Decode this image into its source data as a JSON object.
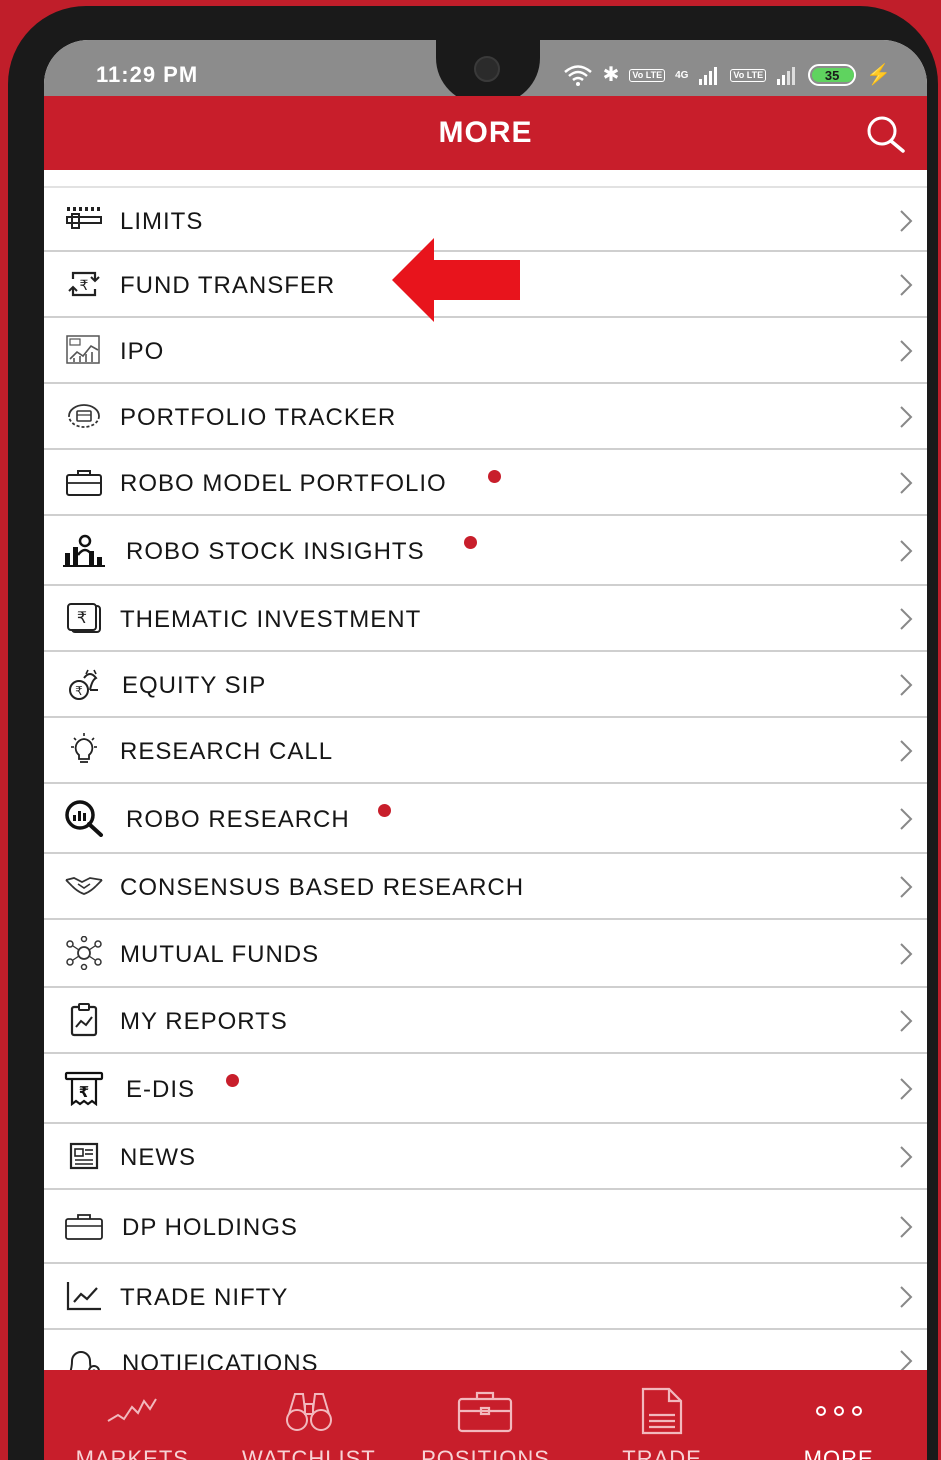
{
  "status_bar": {
    "time": "11:29 PM",
    "network": "4G",
    "lte_badge": "Vo LTE",
    "battery": "35"
  },
  "header": {
    "title": "MORE",
    "search_icon": "search-icon"
  },
  "menu_items": [
    {
      "label": "LIMITS",
      "icon": "limits-icon",
      "dot": false
    },
    {
      "label": "FUND TRANSFER",
      "icon": "fund-transfer-icon",
      "dot": false
    },
    {
      "label": "IPO",
      "icon": "ipo-icon",
      "dot": false
    },
    {
      "label": "PORTFOLIO TRACKER",
      "icon": "portfolio-tracker-icon",
      "dot": false
    },
    {
      "label": "ROBO MODEL PORTFOLIO",
      "icon": "briefcase-icon",
      "dot": true
    },
    {
      "label": "ROBO STOCK INSIGHTS",
      "icon": "stock-insights-icon",
      "dot": true
    },
    {
      "label": "THEMATIC INVESTMENT",
      "icon": "rupee-note-icon",
      "dot": false
    },
    {
      "label": "EQUITY SIP",
      "icon": "sip-icon",
      "dot": false
    },
    {
      "label": "RESEARCH CALL",
      "icon": "lightbulb-icon",
      "dot": false
    },
    {
      "label": "ROBO RESEARCH",
      "icon": "magnifier-chart-icon",
      "dot": true
    },
    {
      "label": "CONSENSUS BASED RESEARCH",
      "icon": "handshake-icon",
      "dot": false
    },
    {
      "label": "MUTUAL FUNDS",
      "icon": "mutual-funds-icon",
      "dot": false
    },
    {
      "label": "MY REPORTS",
      "icon": "clipboard-chart-icon",
      "dot": false
    },
    {
      "label": "E-DIS",
      "icon": "receipt-rupee-icon",
      "dot": true
    },
    {
      "label": "NEWS",
      "icon": "newspaper-icon",
      "dot": false
    },
    {
      "label": "DP HOLDINGS",
      "icon": "briefcase-icon",
      "dot": false
    },
    {
      "label": "TRADE NIFTY",
      "icon": "line-chart-icon",
      "dot": false
    },
    {
      "label": "NOTIFICATIONS",
      "icon": "bell-gear-icon",
      "dot": false
    }
  ],
  "bottom_nav": [
    {
      "label": "MARKETS",
      "icon": "markets-icon",
      "active": false
    },
    {
      "label": "WATCHLIST",
      "icon": "binoculars-icon",
      "active": false
    },
    {
      "label": "POSITIONS",
      "icon": "briefcase-icon",
      "active": false
    },
    {
      "label": "TRADE",
      "icon": "document-icon",
      "active": false
    },
    {
      "label": "MORE",
      "icon": "more-dots-icon",
      "active": true
    }
  ],
  "colors": {
    "brand_red": "#c81e2b",
    "annotation_red": "#e8141c",
    "status_gray": "#8c8c8c"
  }
}
